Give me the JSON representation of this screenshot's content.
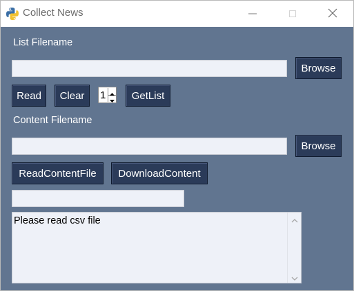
{
  "window": {
    "title": "Collect News",
    "icon": "python-icon"
  },
  "list_section": {
    "label": "List Filename",
    "filename_value": "",
    "browse_label": "Browse",
    "read_label": "Read",
    "clear_label": "Clear",
    "spin_value": "1",
    "getlist_label": "GetList"
  },
  "content_section": {
    "label": "Content Filename",
    "filename_value": "",
    "browse_label": "Browse",
    "read_content_label": "ReadContentFile",
    "download_label": "DownloadContent",
    "status_value": ""
  },
  "output": {
    "text": "Please read csv file"
  },
  "colors": {
    "background": "#617590",
    "button": "#2b3b59",
    "entry": "#eef1f8"
  }
}
